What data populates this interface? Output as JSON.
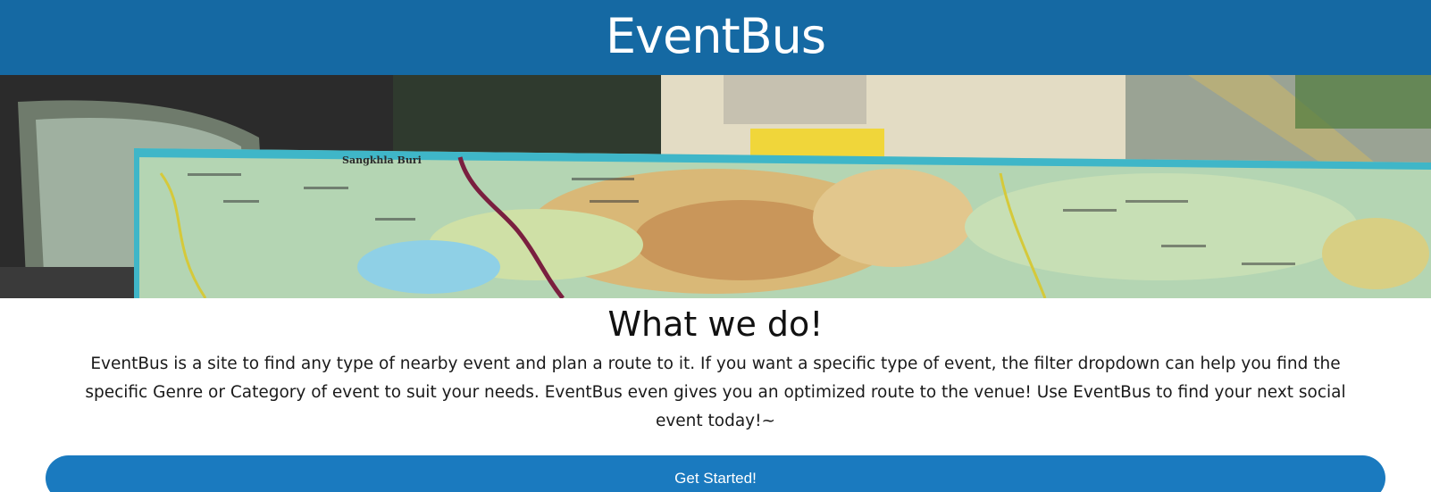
{
  "header": {
    "brand": "EventBus",
    "background_color": "#1569a3"
  },
  "hero": {
    "image": "map-on-car-dashboard-photo",
    "map_place_label": "Sangkhla Buri"
  },
  "about": {
    "title": "What we do!",
    "description": "EventBus is a site to find any type of nearby event and plan a route to it. If you want a specific type of event, the filter dropdown can help you find the specific Genre or Category of event to suit your needs. EventBus even gives you an optimized route to the venue! Use EventBus to find your next social event today!~"
  },
  "cta": {
    "label": "Get Started!",
    "color": "#1a7abf"
  }
}
